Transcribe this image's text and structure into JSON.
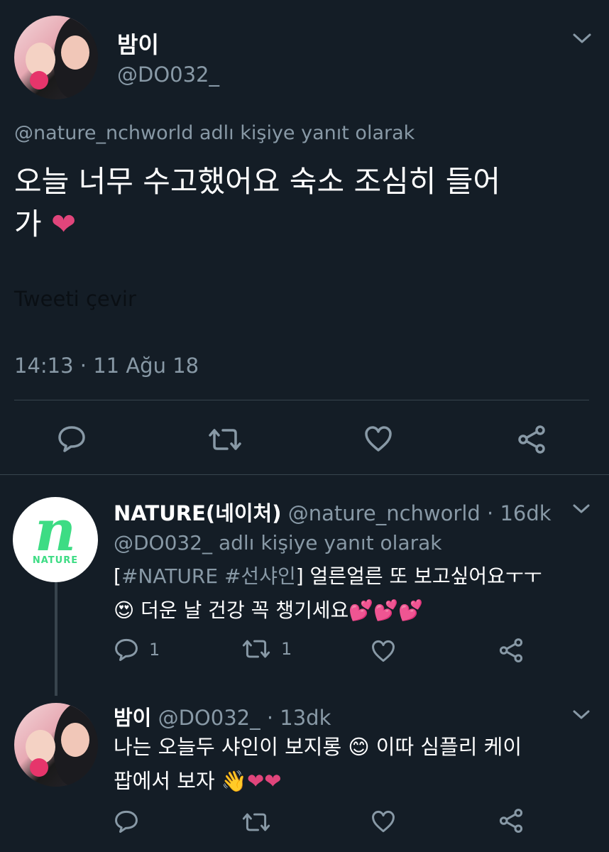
{
  "main_tweet": {
    "display_name": "밤이",
    "handle": "@DO032_",
    "reply_to_handle": "@nature_nchworld",
    "reply_to_suffix": " adlı kişiye yanıt olarak",
    "text_line1": "오늘 너무 수고했어요 숙소 조심히 들어",
    "text_line2": "가 ",
    "heart_emoji": "❤",
    "translate": "Tweeti çevir",
    "timestamp": "14:13 · 11 Ağu 18"
  },
  "reply1": {
    "display_name": "NATURE(네이처)",
    "handle_time": "@nature_nchworld · 16dk",
    "reply_to_handle": "@DO032_",
    "reply_to_suffix": " adlı kişiye yanıt olarak",
    "line1_bracket_open": "[",
    "line1_tags": "#NATURE #선샤인",
    "line1_rest": "] 얼른얼른 또 보고싶어요ㅜㅜ",
    "line2_emoji": "😍",
    "line2_text": " 더운 날 건강 꼭 챙기세요",
    "line2_hearts": "💕💕💕",
    "reply_count": "1",
    "retweet_count": "1",
    "logo_letter": "n",
    "logo_text": "NATURE"
  },
  "reply2": {
    "display_name": "밤이",
    "handle_time": "@DO032_ · 13dk",
    "line1_a": "나는 오늘두 샤인이 보지롱 ",
    "line1_emoji": "😊",
    "line1_b": " 이따 심플리 케이",
    "line2_a": "팝에서 보자 ",
    "line2_emoji": "👋",
    "line2_hearts": "❤❤"
  },
  "colors": {
    "background": "#141d26",
    "muted": "#8899a6",
    "divider": "#38444d",
    "accent": "#1da1f2",
    "heart": "#e0457b",
    "nature_green": "#3ddc84"
  },
  "icons": [
    "chevron-down-icon",
    "reply-icon",
    "retweet-icon",
    "like-icon",
    "share-icon"
  ]
}
